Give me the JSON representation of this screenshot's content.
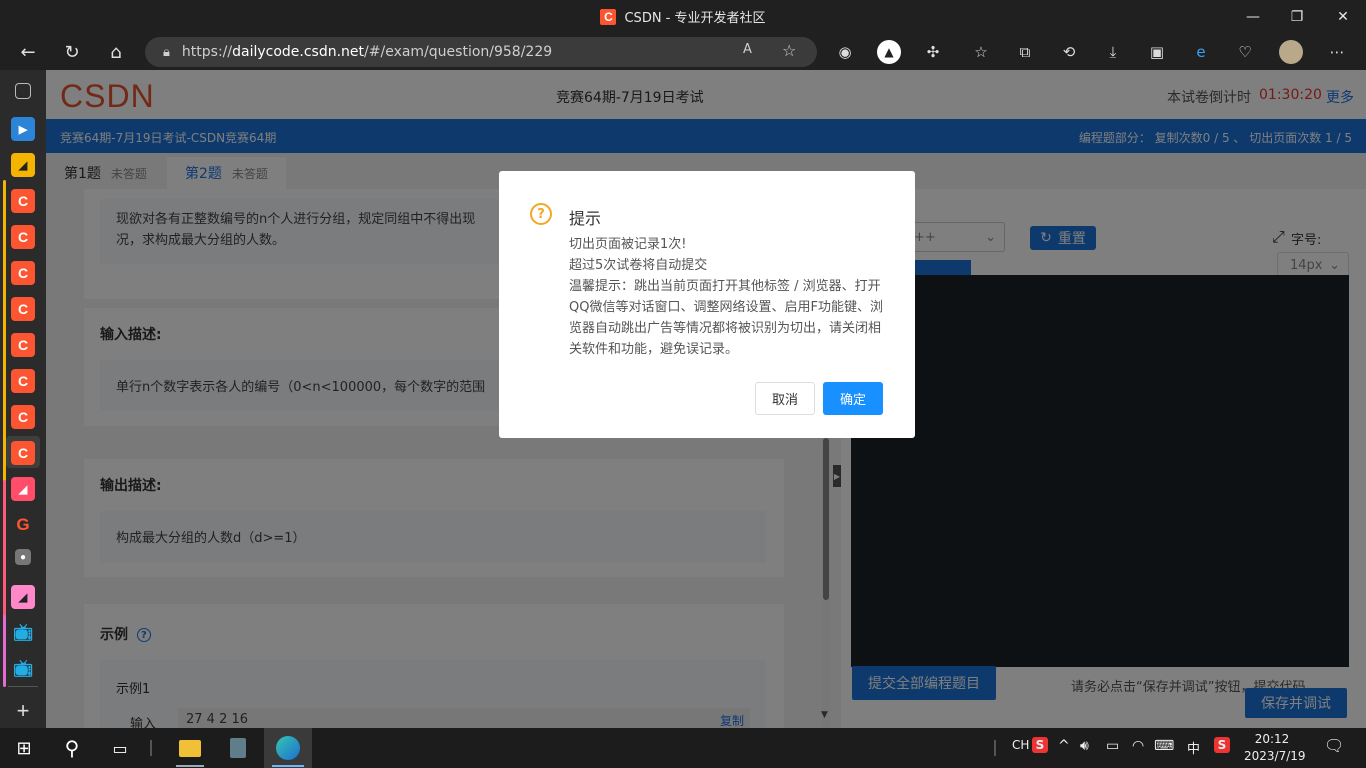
{
  "window": {
    "title": "CSDN - 专业开发者社区",
    "logo_letter": "C"
  },
  "browser": {
    "url_prefix": "https://",
    "url_host": "dailycode.csdn.net",
    "url_path": "/#/exam/question/958/229"
  },
  "page": {
    "logo": "CSDN",
    "exam_title": "竞赛64期-7月19日考试",
    "timer_label": "本试卷倒计时",
    "timer_value": "01:30:20",
    "more_link": "更多",
    "banner_left": "竞赛64期-7月19日考试-CSDN竞赛64期",
    "banner_right": "编程题部分： 复制次数0 / 5 、 切出页面次数 1 / 5",
    "tabs": [
      {
        "label": "第1题",
        "status": "未答题"
      },
      {
        "label": "第2题",
        "status": "未答题"
      }
    ],
    "question_text_line1": "现欲对各有正整数编号的n个人进行分组，规定同组中不得出现",
    "question_text_line2": "况，求构成最大分组的人数。",
    "input_title": "输入描述:",
    "input_desc": "单行n个数字表示各人的编号（0<n<100000，每个数字的范围",
    "output_title": "输出描述:",
    "output_desc": "构成最大分组的人数d（d>=1）",
    "example_title": "示例",
    "example1_title": "示例1",
    "example_input_label": "输入",
    "example_input_value": "27 4 2 16",
    "copy_label": "复制"
  },
  "editor": {
    "language": "++",
    "reset_label": "重置",
    "font_label": "字号:",
    "font_value": "14px",
    "submit_all_label": "提交全部编程题目",
    "hint_text": "请务必点击“保存并调试”按钮，提交代码",
    "save_debug_label": "保存并调试"
  },
  "modal": {
    "title": "提示",
    "line1": "切出页面被记录1次!",
    "line2": "超过5次试卷将自动提交",
    "line3": "温馨提示：跳出当前页面打开其他标签 / 浏览器、打开QQ微信等对话窗口、调整网络设置、启用F功能键、浏览器自动跳出广告等情况都将被识别为切出，请关闭相关软件和功能，避免误记录。",
    "cancel_label": "取消",
    "ok_label": "确定"
  },
  "taskbar": {
    "ime_lang": "CH",
    "ime_mode": "中",
    "time": "20:12",
    "date": "2023/7/19"
  }
}
